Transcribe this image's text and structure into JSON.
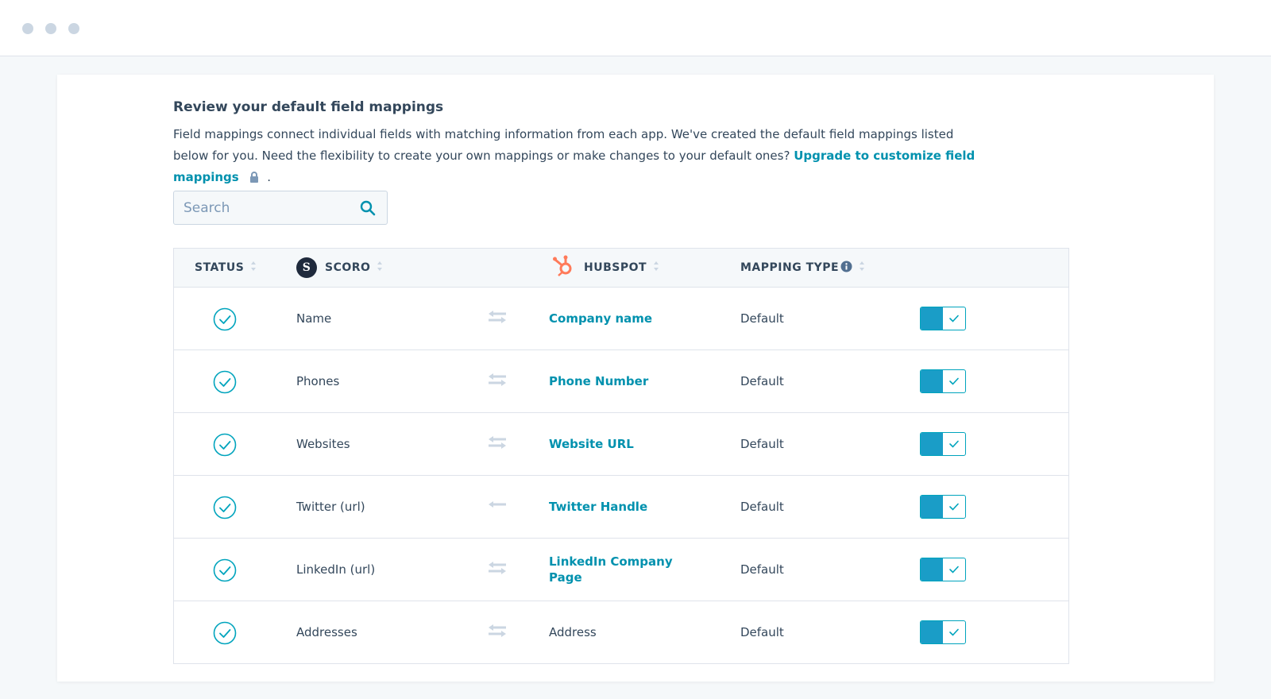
{
  "window": {
    "dots": [
      "#cbd6e2",
      "#cbd6e2",
      "#cbd6e2"
    ]
  },
  "section": {
    "title": "Review your default field mappings",
    "description": "Field mappings connect individual fields with matching information from each app. We've created the default field mappings listed below for you. Need the flexibility to create your own mappings or make changes to your default ones?",
    "upgrade_link": "Upgrade to customize field mappings",
    "trailing": ".",
    "lock_icon": "lock-icon"
  },
  "search": {
    "placeholder": "Search",
    "value": "",
    "icon": "search-icon"
  },
  "table": {
    "headers": {
      "status": "STATUS",
      "scoro": "SCORO",
      "scoro_logo_letter": "S",
      "hubspot": "HUBSPOT",
      "mapping_type": "MAPPING TYPE"
    },
    "rows": [
      {
        "scoro": "Name",
        "hubspot": "Company name",
        "hubspot_link": true,
        "sync": "two-way",
        "type": "Default",
        "enabled": true
      },
      {
        "scoro": "Phones",
        "hubspot": "Phone Number",
        "hubspot_link": true,
        "sync": "two-way",
        "type": "Default",
        "enabled": true
      },
      {
        "scoro": "Websites",
        "hubspot": "Website URL",
        "hubspot_link": true,
        "sync": "two-way",
        "type": "Default",
        "enabled": true
      },
      {
        "scoro": "Twitter (url)",
        "hubspot": "Twitter Handle",
        "hubspot_link": true,
        "sync": "one-way",
        "type": "Default",
        "enabled": true
      },
      {
        "scoro": "LinkedIn (url)",
        "hubspot": "LinkedIn Company Page",
        "hubspot_link": true,
        "sync": "two-way",
        "type": "Default",
        "enabled": true
      },
      {
        "scoro": "Addresses",
        "hubspot": "Address",
        "hubspot_link": false,
        "sync": "two-way",
        "type": "Default",
        "enabled": true
      }
    ]
  },
  "colors": {
    "accent_link": "#0091ae",
    "toggle_on": "#1a9dc7",
    "status_ok": "#00a4bd",
    "hubspot_orange": "#ff7a59",
    "text": "#33475b"
  }
}
